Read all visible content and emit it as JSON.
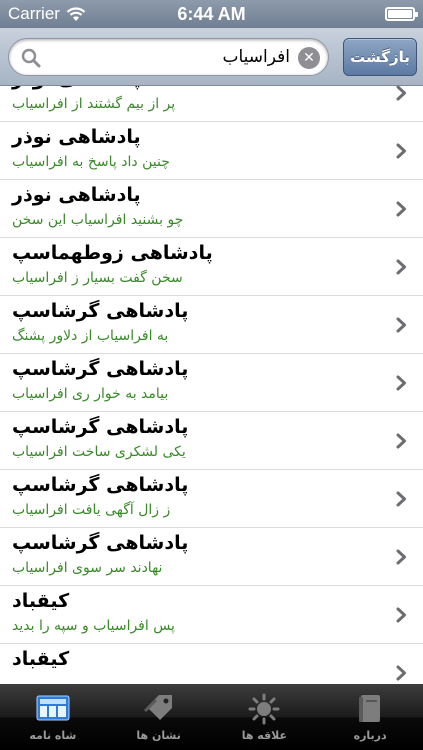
{
  "status": {
    "carrier": "Carrier",
    "time": "6:44 AM",
    "battery_level": 1.0
  },
  "search": {
    "value": "افراسیاب",
    "back_label": "بازگشت"
  },
  "results": [
    {
      "title": "پادشاهی نوذر",
      "subtitle": "پر از بیم گشتند از افراسیاب"
    },
    {
      "title": "پادشاهی نوذر",
      "subtitle": "چنین داد پاسخ به افراسیاب"
    },
    {
      "title": "پادشاهی نوذر",
      "subtitle": "چو بشنید افراسیاب این سخن"
    },
    {
      "title": "پادشاهی زوطهماسپ",
      "subtitle": "سخن گفت بسیار ز افراسیاب"
    },
    {
      "title": "پادشاهی گرشاسپ",
      "subtitle": "به افراسیاب از دلاور پشنگ"
    },
    {
      "title": "پادشاهی گرشاسپ",
      "subtitle": "بیامد به خوار ری افراسیاب"
    },
    {
      "title": "پادشاهی گرشاسپ",
      "subtitle": "یکی لشکری ساخت افراسیاب"
    },
    {
      "title": "پادشاهی گرشاسپ",
      "subtitle": "ز زال آگهی یافت افراسیاب"
    },
    {
      "title": "پادشاهی گرشاسپ",
      "subtitle": "نهادند سر سوی افراسیاب"
    },
    {
      "title": "کیقباد",
      "subtitle": "پس افراسیاب و سپه را بدید"
    },
    {
      "title": "کیقباد",
      "subtitle": ""
    }
  ],
  "tabs": [
    {
      "label": "شاه نامه",
      "icon": "book-shelf-icon",
      "active": true
    },
    {
      "label": "نشان ها",
      "icon": "tag-icon",
      "active": false
    },
    {
      "label": "علاقه ها",
      "icon": "sun-icon",
      "active": false
    },
    {
      "label": "درباره",
      "icon": "book-icon",
      "active": false
    }
  ],
  "colors": {
    "subtitle": "#3a8a2a",
    "accent": "#5c7aa3"
  }
}
